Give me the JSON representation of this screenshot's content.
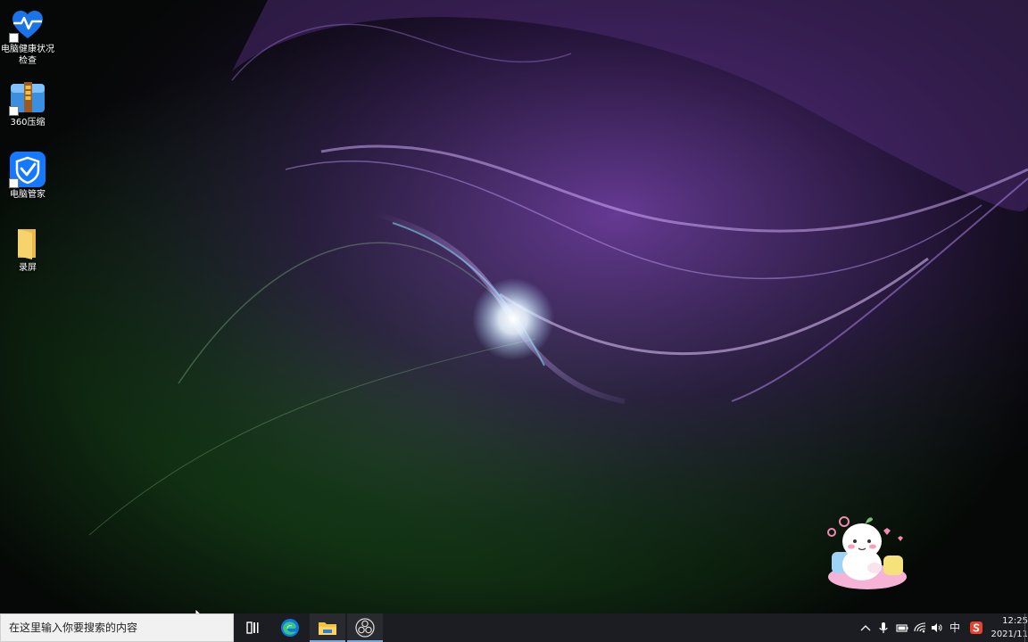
{
  "desktop": {
    "icons": [
      {
        "label": "电脑健康状况检查",
        "icon": "health-check-icon"
      },
      {
        "label": "360压缩",
        "icon": "archive-icon"
      },
      {
        "label": "电脑管家",
        "icon": "pc-manager-icon"
      },
      {
        "label": "录屏",
        "icon": "folder-icon"
      }
    ]
  },
  "taskbar": {
    "search_placeholder": "在这里输入你要搜索的内容",
    "apps": [
      {
        "icon": "task-view-icon"
      },
      {
        "icon": "edge-icon"
      },
      {
        "icon": "file-explorer-icon",
        "active": true
      },
      {
        "icon": "obs-icon",
        "active": true
      }
    ],
    "tray": {
      "ime_label": "中",
      "clock_time": "12:25",
      "clock_date": "2021/11"
    }
  },
  "colors": {
    "taskbar_bg": "#1c1d22",
    "search_bg": "#f1f1f1",
    "active_indicator": "#7aa6d9"
  }
}
